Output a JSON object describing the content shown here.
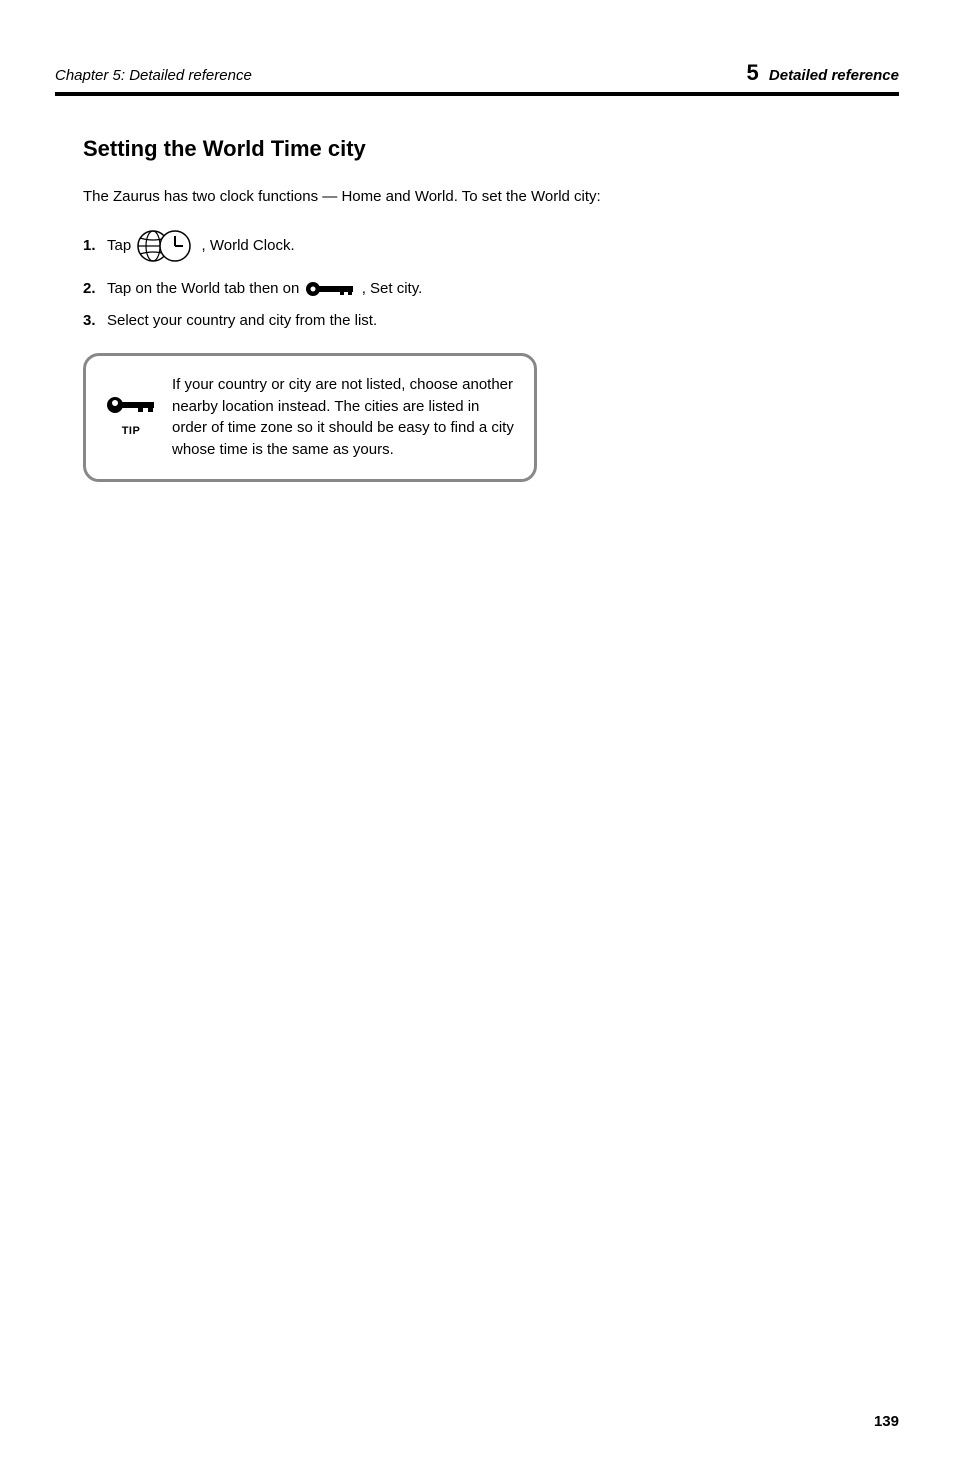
{
  "header": {
    "left": "Chapter 5: Detailed reference",
    "chapter_num": "5",
    "chapter_title": "Detailed reference"
  },
  "section": {
    "title": "Setting the World Time city",
    "intro": "The Zaurus has two clock functions — Home and World. To set the World city:",
    "step1_num": "1.",
    "step1_text_before": "Tap ",
    "step1_text_after": ", World Clock.",
    "step2_num": "2.",
    "step2_text_before": "Tap on the World tab then on ",
    "step2_text_after": ", Set city.",
    "step3_num": "3.",
    "step3_text": "Select your country and city from the list."
  },
  "tip": {
    "label": "TIP",
    "text": "If your country or city are not listed, choose another nearby location instead. The cities are listed in order of time zone so it should be easy to find a city whose time is the same as yours."
  },
  "page_number": "139"
}
